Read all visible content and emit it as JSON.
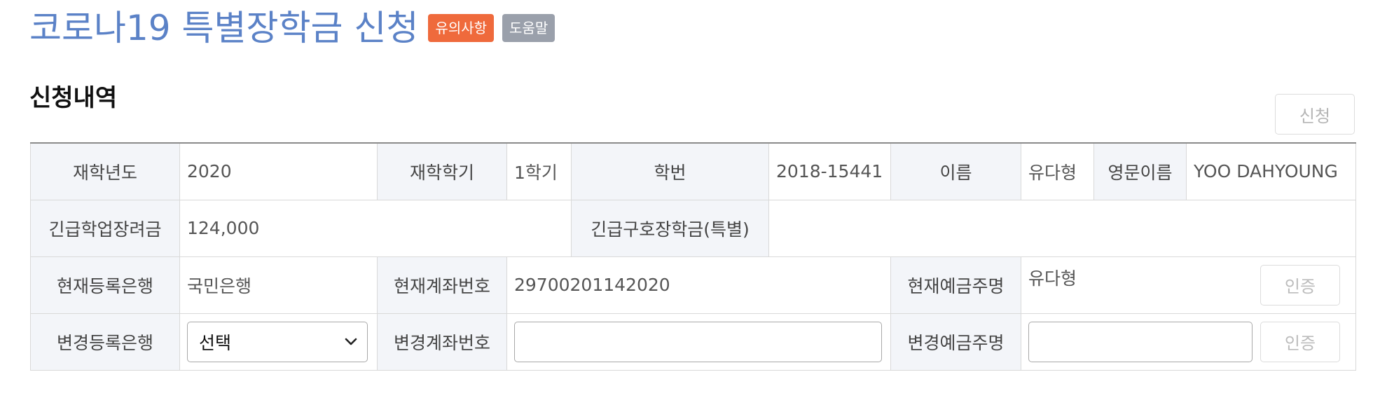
{
  "header": {
    "title": "코로나19 특별장학금 신청",
    "badge_notice": "유의사항",
    "badge_help": "도움말",
    "colors": {
      "title": "#5b82c7",
      "notice": "#ef6a3c",
      "help": "#9aa0ab"
    }
  },
  "section": {
    "title": "신청내역",
    "apply_label": "신청"
  },
  "info": {
    "row1": {
      "year_label": "재학년도",
      "year_value": "2020",
      "semester_label": "재학학기",
      "semester_value": "1학기",
      "student_id_label": "학번",
      "student_id_value": "2018-15441",
      "name_label": "이름",
      "name_value": "유다형",
      "eng_name_label": "영문이름",
      "eng_name_value": "YOO DAHYOUNG"
    },
    "row2": {
      "emergency_study_label": "긴급학업장려금",
      "emergency_study_value": "124,000",
      "emergency_relief_label": "긴급구호장학금(특별)",
      "emergency_relief_value": ""
    },
    "row3": {
      "current_bank_label": "현재등록은행",
      "current_bank_value": "국민은행",
      "current_account_label": "현재계좌번호",
      "current_account_value": "29700201142020",
      "current_holder_label": "현재예금주명",
      "current_holder_value": "유다형",
      "verify_label": "인증"
    },
    "row4": {
      "new_bank_label": "변경등록은행",
      "new_bank_selected": "선택",
      "new_account_label": "변경계좌번호",
      "new_account_value": "",
      "new_holder_label": "변경예금주명",
      "new_holder_value": "",
      "verify_label": "인증"
    }
  }
}
